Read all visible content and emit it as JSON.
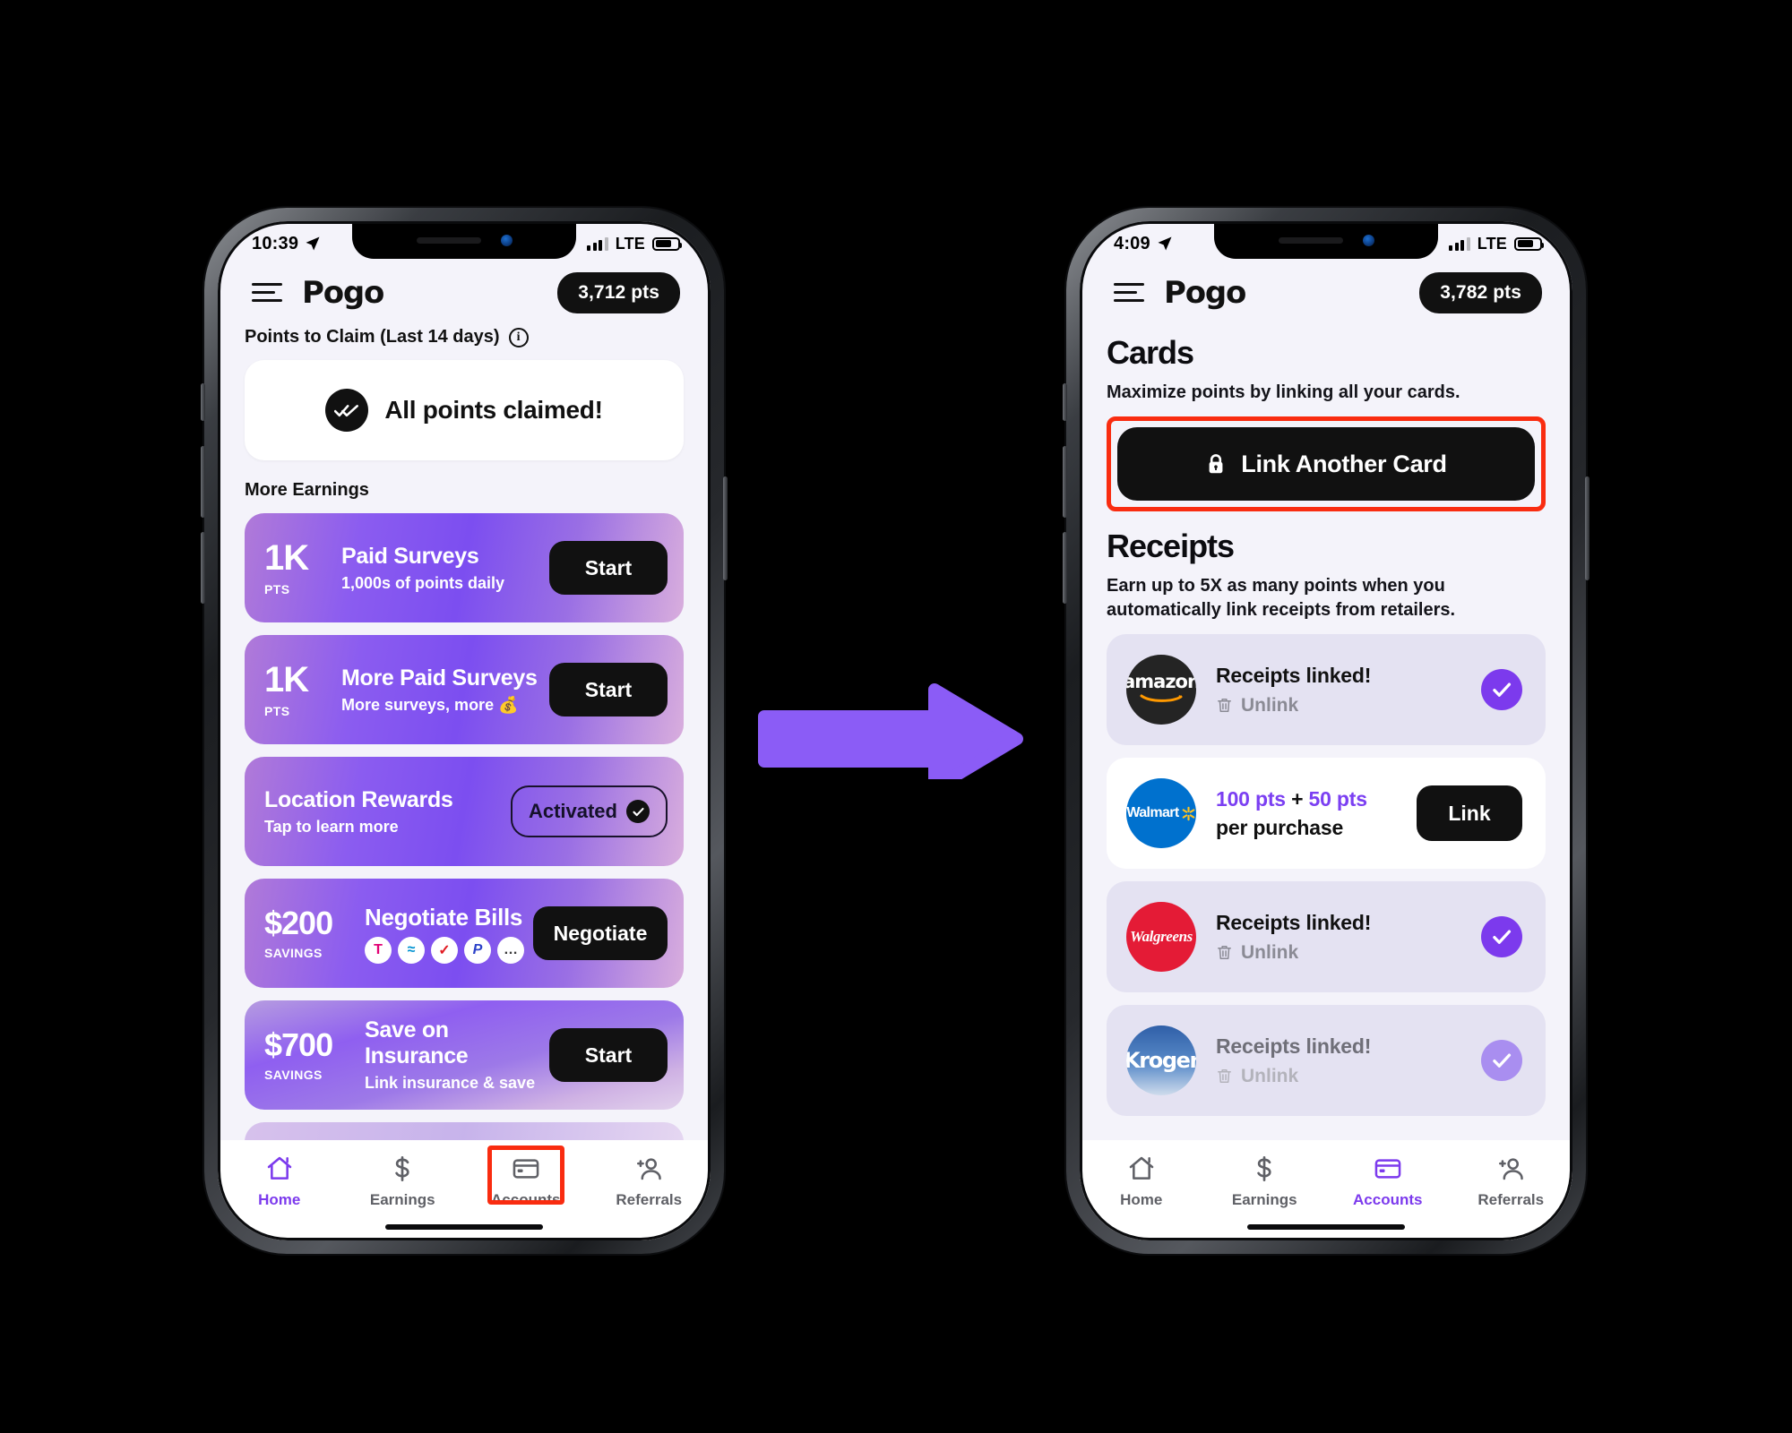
{
  "arrow": {
    "name": "flow-arrow",
    "color": "#8b5cf6"
  },
  "phones": [
    {
      "id": "left",
      "status": {
        "time": "10:39",
        "network": "LTE"
      },
      "header": {
        "brand": "Pogo",
        "points": "3,712 pts"
      },
      "home": {
        "claim_label": "Points to Claim (Last 14 days)",
        "info_icon": "i",
        "claim_text": "All points claimed!",
        "more_label": "More Earnings",
        "cards": [
          {
            "amount": "1K",
            "unit": "PTS",
            "title": "Paid Surveys",
            "subtitle": "1,000s of points daily",
            "action": "Start",
            "type": "button"
          },
          {
            "amount": "1K",
            "unit": "PTS",
            "title": "More Paid Surveys",
            "subtitle": "More surveys, more 💰",
            "action": "Start",
            "type": "button"
          },
          {
            "amount": "",
            "unit": "",
            "title": "Location Rewards",
            "subtitle": "Tap to learn more",
            "action": "Activated",
            "type": "pill"
          },
          {
            "amount": "$200",
            "unit": "SAVINGS",
            "title": "Negotiate Bills",
            "subtitle": "",
            "action": "Negotiate",
            "type": "button",
            "billers": [
              "T",
              "≈",
              "✓",
              "P",
              "…"
            ]
          },
          {
            "amount": "$700",
            "unit": "SAVINGS",
            "title": "Save on Insurance",
            "subtitle": "Link insurance & save",
            "action": "Start",
            "type": "button"
          }
        ]
      },
      "tabs": [
        {
          "label": "Home",
          "icon": "home-icon",
          "active": true,
          "highlighted": false
        },
        {
          "label": "Earnings",
          "icon": "dollar-icon",
          "active": false,
          "highlighted": false
        },
        {
          "label": "Accounts",
          "icon": "card-icon",
          "active": false,
          "highlighted": true
        },
        {
          "label": "Referrals",
          "icon": "add-person-icon",
          "active": false,
          "highlighted": false
        }
      ]
    },
    {
      "id": "right",
      "status": {
        "time": "4:09",
        "network": "LTE"
      },
      "header": {
        "brand": "Pogo",
        "points": "3,782 pts"
      },
      "accounts": {
        "cards_title": "Cards",
        "cards_sub": "Maximize points by linking all your cards.",
        "link_button": "Link Another Card",
        "receipts_title": "Receipts",
        "receipts_sub": "Earn up to 5X as many points when you automatically link receipts from retailers.",
        "retailers": [
          {
            "brand": "amazon",
            "logo_text": "amazon",
            "state": "linked",
            "title": "Receipts linked!",
            "unlink": "Unlink",
            "check": "solid"
          },
          {
            "brand": "walmart",
            "logo_text": "Walmart",
            "state": "unlinked",
            "offer_primary": "100 pts",
            "offer_plus": "+",
            "offer_secondary": "50 pts",
            "offer_sub": "per purchase",
            "action": "Link"
          },
          {
            "brand": "walgreens",
            "logo_text": "Walgreens",
            "state": "linked",
            "title": "Receipts linked!",
            "unlink": "Unlink",
            "check": "solid"
          },
          {
            "brand": "kroger",
            "logo_text": "Kroger",
            "state": "linked",
            "title": "Receipts linked!",
            "unlink": "Unlink",
            "check": "pale"
          }
        ]
      },
      "tabs": [
        {
          "label": "Home",
          "icon": "home-icon",
          "active": false,
          "highlighted": false
        },
        {
          "label": "Earnings",
          "icon": "dollar-icon",
          "active": false,
          "highlighted": false
        },
        {
          "label": "Accounts",
          "icon": "card-icon",
          "active": true,
          "highlighted": false
        },
        {
          "label": "Referrals",
          "icon": "add-person-icon",
          "active": false,
          "highlighted": false
        }
      ]
    }
  ]
}
